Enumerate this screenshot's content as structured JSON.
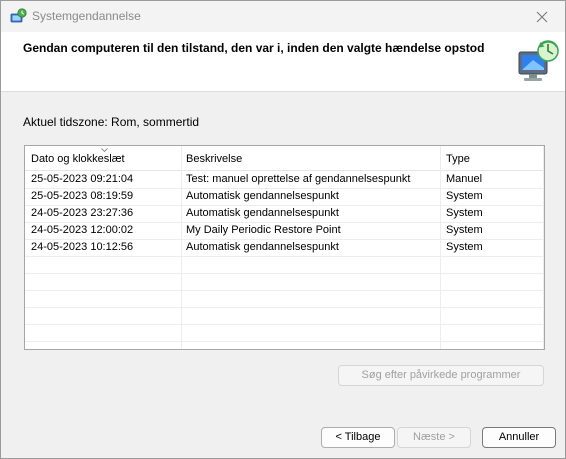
{
  "window": {
    "title": "Systemgendannelse",
    "close_icon": "close-icon"
  },
  "header": {
    "text": "Gendan computeren til den tilstand, den var i, inden den valgte hændelse opstod",
    "icon": "system-restore-icon"
  },
  "timezone_label": "Aktuel tidszone: Rom, sommertid",
  "list": {
    "columns": [
      "Dato og klokkeslæt",
      "Beskrivelse",
      "Type"
    ],
    "sorted_column": "Dato og klokkeslæt",
    "rows": [
      {
        "date": "25-05-2023 09:21:04",
        "description": "Test: manuel oprettelse af gendannelsespunkt",
        "type": "Manuel"
      },
      {
        "date": "25-05-2023 08:19:59",
        "description": "Automatisk gendannelsespunkt",
        "type": "System"
      },
      {
        "date": "24-05-2023 23:27:36",
        "description": "Automatisk gendannelsespunkt",
        "type": "System"
      },
      {
        "date": "24-05-2023 12:00:02",
        "description": "My Daily Periodic Restore Point",
        "type": "System"
      },
      {
        "date": "24-05-2023 10:12:56",
        "description": "Automatisk gendannelsespunkt",
        "type": "System"
      }
    ]
  },
  "buttons": {
    "scan": "Søg efter påvirkede programmer",
    "back": "< Tilbage",
    "next": "Næste >",
    "cancel": "Annuller"
  }
}
